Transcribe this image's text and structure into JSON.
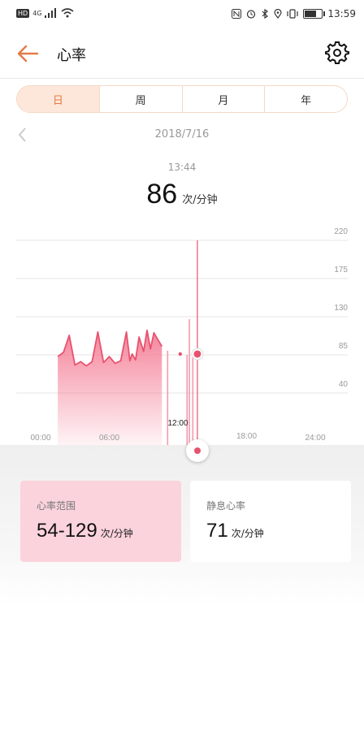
{
  "status": {
    "network": "4G",
    "time": "13:59"
  },
  "header": {
    "title": "心率"
  },
  "tabs": [
    "日",
    "周",
    "月",
    "年"
  ],
  "date": "2018/7/16",
  "selected": {
    "time": "13:44",
    "value": "86",
    "unit": "次/分钟"
  },
  "chart_data": {
    "type": "area",
    "xlim": [
      0,
      24
    ],
    "ylim": [
      0,
      220
    ],
    "y_ticks": [
      220,
      175,
      130,
      85,
      40
    ],
    "x_ticks": [
      {
        "label": "00:00",
        "x": 0
      },
      {
        "label": "06:00",
        "x": 6
      },
      {
        "label": "12:00",
        "x": 12
      },
      {
        "label": "18:00",
        "x": 18
      },
      {
        "label": "24:00",
        "x": 24
      }
    ],
    "series": [
      {
        "values": [
          [
            1.5,
            83
          ],
          [
            2,
            88
          ],
          [
            2.5,
            108
          ],
          [
            3,
            73
          ],
          [
            3.5,
            77
          ],
          [
            4,
            72
          ],
          [
            4.5,
            77
          ],
          [
            5,
            112
          ],
          [
            5.5,
            76
          ],
          [
            6,
            83
          ],
          [
            6.5,
            75
          ],
          [
            7,
            78
          ],
          [
            7.5,
            112
          ],
          [
            7.8,
            78
          ],
          [
            8,
            86
          ],
          [
            8.3,
            79
          ],
          [
            8.6,
            106
          ],
          [
            9,
            89
          ],
          [
            9.3,
            114
          ],
          [
            9.6,
            92
          ],
          [
            9.9,
            111
          ],
          [
            10.2,
            104
          ],
          [
            10.6,
            95
          ]
        ],
        "segments": [
          [
            11.1,
            90
          ],
          [
            12.8,
            85
          ],
          [
            13,
            127
          ],
          [
            13.3,
            86
          ]
        ]
      }
    ],
    "selected_point": {
      "x": 13.7,
      "y": 86,
      "label": "13:44"
    },
    "stray_point": {
      "x": 12.2,
      "y": 86
    },
    "colors": {
      "line": "#e8526e",
      "fill": "#f36f8a"
    }
  },
  "cards": {
    "range": {
      "label": "心率范围",
      "value": "54-129",
      "unit": "次/分钟"
    },
    "rest": {
      "label": "静息心率",
      "value": "71",
      "unit": "次/分钟"
    }
  }
}
